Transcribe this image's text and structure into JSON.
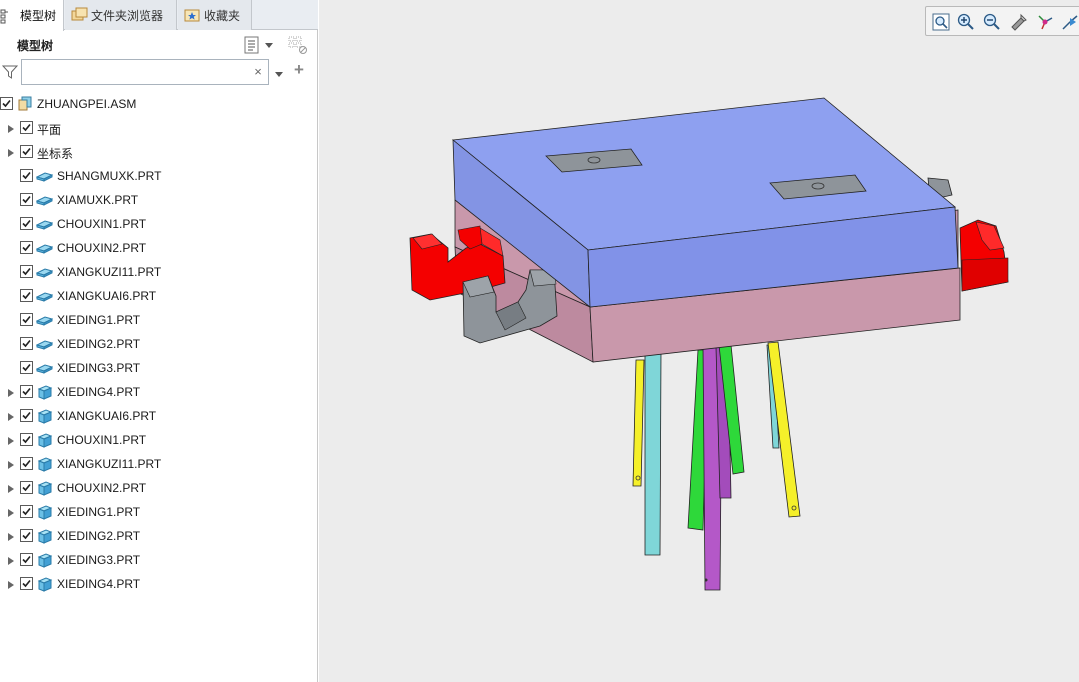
{
  "tabs": [
    {
      "id": "model",
      "label": "模型树",
      "active": true
    },
    {
      "id": "folder",
      "label": "文件夹浏览器",
      "active": false
    },
    {
      "id": "fav",
      "label": "收藏夹",
      "active": false
    }
  ],
  "tree": {
    "title": "模型树",
    "search": {
      "value": "",
      "placeholder": ""
    },
    "root": {
      "label": "ZHUANGPEI.ASM",
      "checked": true
    },
    "items": [
      {
        "label": "平面",
        "type": "folder",
        "expandable": true,
        "checked": true
      },
      {
        "label": "坐标系",
        "type": "folder",
        "expandable": true,
        "checked": true
      },
      {
        "label": "SHANGMUXK.PRT",
        "type": "flat-part",
        "expandable": false,
        "checked": true
      },
      {
        "label": "XIAMUXK.PRT",
        "type": "flat-part",
        "expandable": false,
        "checked": true
      },
      {
        "label": "CHOUXIN1.PRT",
        "type": "flat-part",
        "expandable": false,
        "checked": true
      },
      {
        "label": "CHOUXIN2.PRT",
        "type": "flat-part",
        "expandable": false,
        "checked": true
      },
      {
        "label": "XIANGKUZI11.PRT",
        "type": "flat-part",
        "expandable": false,
        "checked": true
      },
      {
        "label": "XIANGKUAI6.PRT",
        "type": "flat-part",
        "expandable": false,
        "checked": true
      },
      {
        "label": "XIEDING1.PRT",
        "type": "flat-part",
        "expandable": false,
        "checked": true
      },
      {
        "label": "XIEDING2.PRT",
        "type": "flat-part",
        "expandable": false,
        "checked": true
      },
      {
        "label": "XIEDING3.PRT",
        "type": "flat-part",
        "expandable": false,
        "checked": true
      },
      {
        "label": "XIEDING4.PRT",
        "type": "solid-part",
        "expandable": true,
        "checked": true
      },
      {
        "label": "XIANGKUAI6.PRT",
        "type": "solid-part",
        "expandable": true,
        "checked": true
      },
      {
        "label": "CHOUXIN1.PRT",
        "type": "solid-part",
        "expandable": true,
        "checked": true
      },
      {
        "label": "XIANGKUZI11.PRT",
        "type": "solid-part",
        "expandable": true,
        "checked": true
      },
      {
        "label": "CHOUXIN2.PRT",
        "type": "solid-part",
        "expandable": true,
        "checked": true
      },
      {
        "label": "XIEDING1.PRT",
        "type": "solid-part",
        "expandable": true,
        "checked": true
      },
      {
        "label": "XIEDING2.PRT",
        "type": "solid-part",
        "expandable": true,
        "checked": true
      },
      {
        "label": "XIEDING3.PRT",
        "type": "solid-part",
        "expandable": true,
        "checked": true
      },
      {
        "label": "XIEDING4.PRT",
        "type": "solid-part",
        "expandable": true,
        "checked": true
      }
    ]
  },
  "view_toolbar": [
    "refit-icon",
    "zoom-in-icon",
    "zoom-out-icon",
    "repaint-icon",
    "spin-center-icon",
    "named-view-icon"
  ],
  "colors": {
    "top_plate": "#8ea0f0",
    "bottom_plate": "#c998ab",
    "slider": "#f40000",
    "block": "#8e949a",
    "pin_yellow": "#f5f02a",
    "pin_cyan": "#7fd6d8",
    "pin_green": "#2ed83a",
    "pin_purple": "#b458c8"
  }
}
